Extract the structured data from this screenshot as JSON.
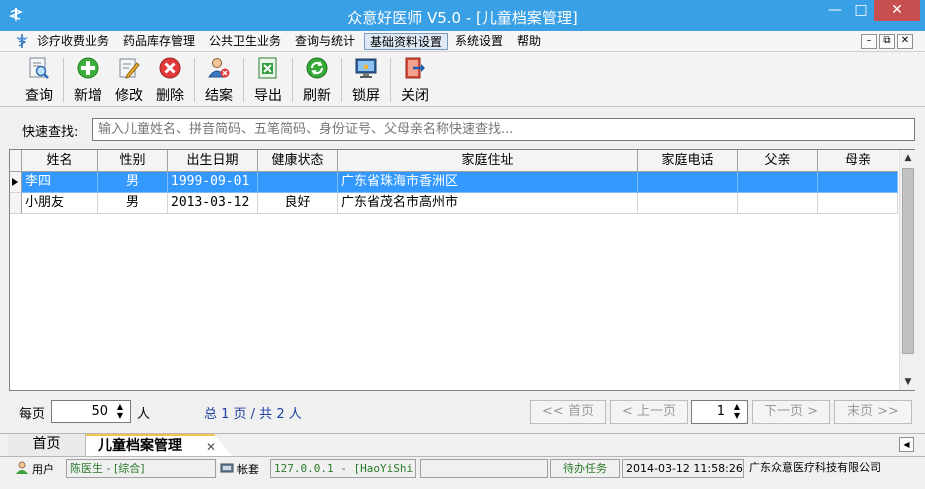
{
  "window": {
    "title": "众意好医师 V5.0 - [儿童档案管理]",
    "minimize": "—",
    "maximize": "□",
    "close": "✕"
  },
  "menu": {
    "items": [
      "诊疗收费业务",
      "药品库存管理",
      "公共卫生业务",
      "查询与统计",
      "基础资料设置",
      "系统设置",
      "帮助"
    ],
    "mdi": {
      "minimize": "–",
      "restore": "⧉",
      "close": "✕"
    }
  },
  "toolbar": {
    "query": "查询",
    "add": "新增",
    "edit": "修改",
    "delete": "删除",
    "close_case": "结案",
    "export": "导出",
    "refresh": "刷新",
    "lock": "锁屏",
    "close": "关闭"
  },
  "search": {
    "label": "快速查找:",
    "placeholder": "输入儿童姓名、拼音简码、五笔简码、身份证号、父母亲名称快速查找..."
  },
  "grid": {
    "columns": [
      "姓名",
      "性别",
      "出生日期",
      "健康状态",
      "家庭住址",
      "家庭电话",
      "父亲",
      "母亲"
    ],
    "rows": [
      {
        "name": "李四",
        "gender": "男",
        "birth": "1999-09-01",
        "health": "",
        "address": "广东省珠海市香洲区",
        "phone": "",
        "father": "",
        "mother": ""
      },
      {
        "name": "小朋友",
        "gender": "男",
        "birth": "2013-03-12",
        "health": "良好",
        "address": "广东省茂名市高州市",
        "phone": "",
        "father": "",
        "mother": ""
      }
    ]
  },
  "pager": {
    "per_page_label": "每页",
    "per_page": "50",
    "unit": "人",
    "summary": "总 1 页 / 共 2 人",
    "first": "<< 首页",
    "prev": "< 上一页",
    "page": "1",
    "next": "下一页 >",
    "last": "末页 >>"
  },
  "tabs": {
    "home": "首页",
    "current": "儿童档案管理",
    "close": "✕"
  },
  "status": {
    "user_label": "用户",
    "user": "陈医生 - [综合]",
    "account_label": "帐套",
    "account": "127.0.0.1 - [HaoYiShi]",
    "tasks": "待办任务",
    "time": "2014-03-12 11:58:26",
    "company": "广东众意医疗科技有限公司"
  },
  "colors": {
    "title_bar": "#3aa0e6",
    "selection": "#3399ff",
    "close_button": "#c74f50"
  }
}
